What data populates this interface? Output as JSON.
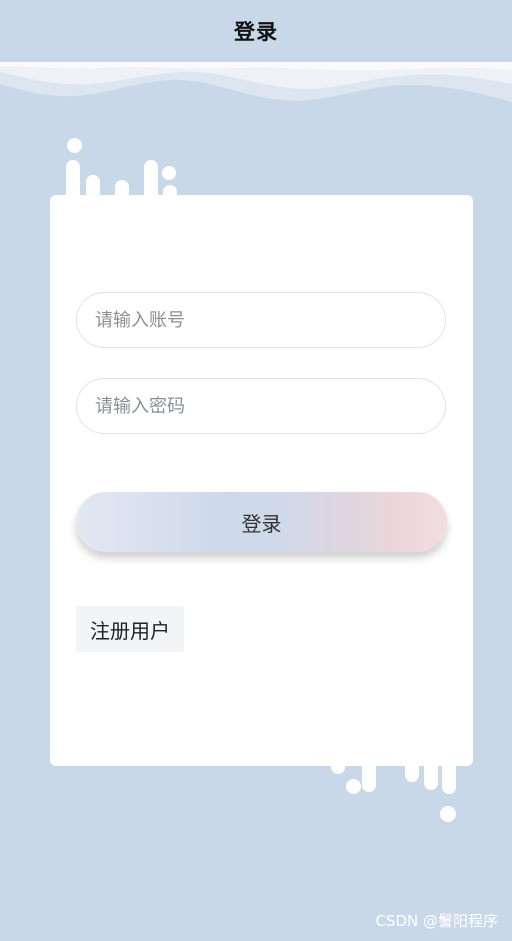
{
  "header": {
    "title": "登录"
  },
  "form": {
    "account_placeholder": "请输入账号",
    "password_placeholder": "请输入密码",
    "login_label": "登录",
    "register_label": "注册用户"
  },
  "watermark": "CSDN @鬐阳程序",
  "colors": {
    "background": "#c9d8e8",
    "card": "#ffffff",
    "button_gradient_start": "#e3e8f2",
    "button_gradient_end": "#f2dde0"
  }
}
